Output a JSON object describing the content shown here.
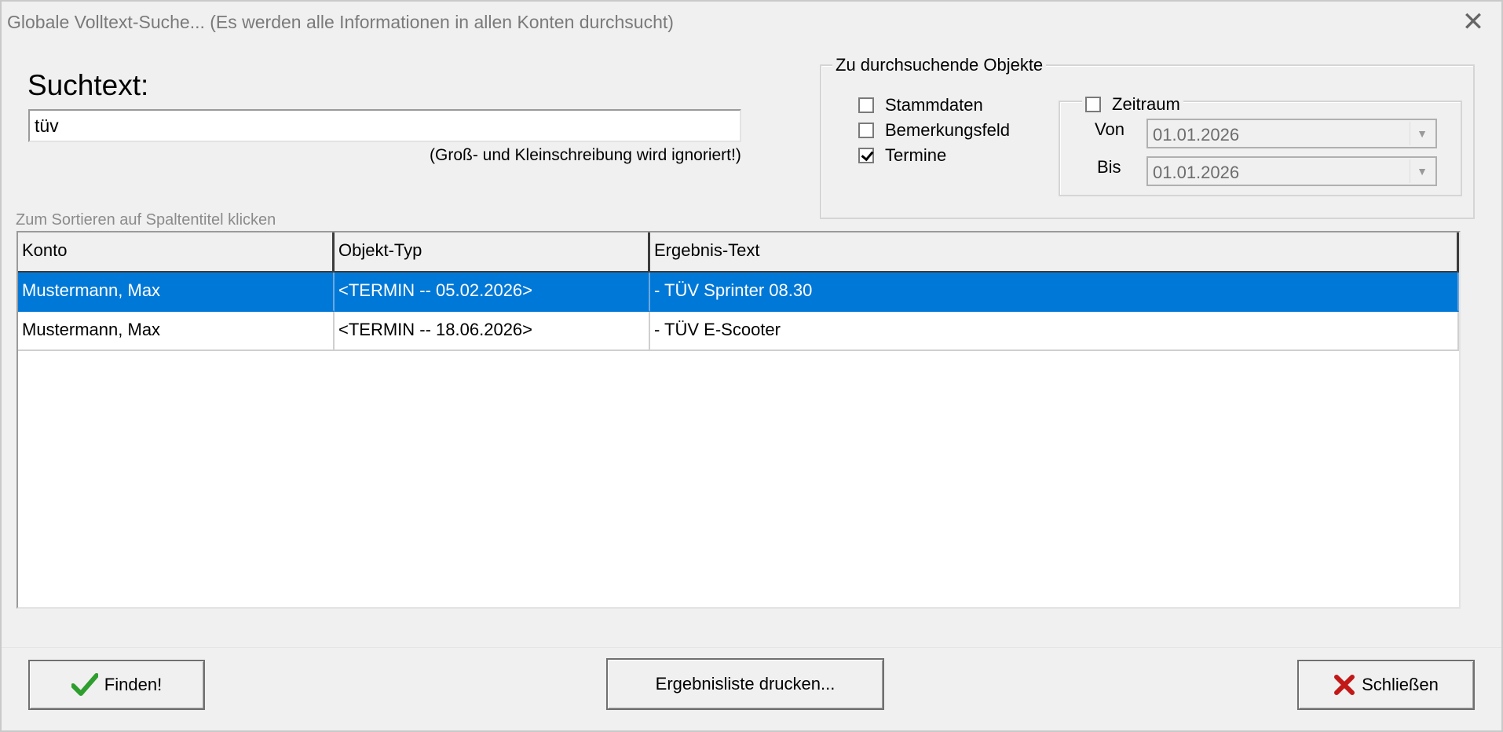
{
  "window": {
    "title": "Globale Volltext-Suche...  (Es werden alle Informationen in allen Konten durchsucht)",
    "close_glyph": "✕"
  },
  "search": {
    "label": "Suchtext:",
    "value": "tüv",
    "hint": "(Groß- und Kleinschreibung wird ignoriert!)"
  },
  "objects_group": {
    "legend": "Zu durchsuchende Objekte",
    "checkboxes": [
      {
        "label": "Stammdaten",
        "checked": false
      },
      {
        "label": "Bemerkungsfeld",
        "checked": false
      },
      {
        "label": "Termine",
        "checked": true
      }
    ]
  },
  "zeitraum": {
    "label": "Zeitraum",
    "checked": false,
    "von_label": "Von",
    "von_value": "01.01.2026",
    "bis_label": "Bis",
    "bis_value": "01.01.2026"
  },
  "results": {
    "sort_hint": "Zum Sortieren auf Spaltentitel klicken",
    "columns": [
      "Konto",
      "Objekt-Typ",
      "Ergebnis-Text"
    ],
    "rows": [
      {
        "konto": "Mustermann, Max",
        "objekt_typ": "<TERMIN -- 05.02.2026>",
        "ergebnis": "- TÜV Sprinter 08.30",
        "selected": true
      },
      {
        "konto": "Mustermann, Max",
        "objekt_typ": "<TERMIN -- 18.06.2026>",
        "ergebnis": "- TÜV E-Scooter",
        "selected": false
      }
    ]
  },
  "buttons": {
    "find": "Finden!",
    "print": "Ergebnisliste drucken...",
    "close": "Schließen"
  },
  "colors": {
    "selection": "#0078d7",
    "check_green": "#2e9e2e",
    "close_red": "#c21818"
  },
  "icons": {
    "find": "check-icon",
    "close": "red-x-icon"
  }
}
